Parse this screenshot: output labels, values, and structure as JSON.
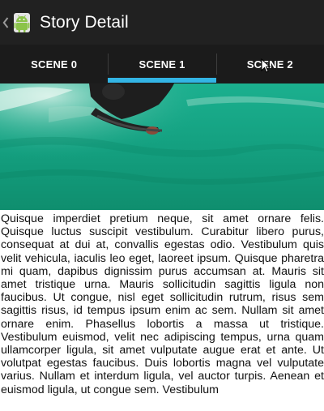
{
  "action_bar": {
    "title": "Story Detail",
    "up_icon": "chevron-left-icon",
    "app_icon": "android-icon"
  },
  "tabs": [
    {
      "label": "SCENE 0",
      "selected": false
    },
    {
      "label": "SCENE 1",
      "selected": true
    },
    {
      "label": "SCENE 2",
      "selected": false
    }
  ],
  "colors": {
    "action_bar_bg": "#212121",
    "tab_bar_bg": "#1b1b1b",
    "tab_indicator": "#33b5e5",
    "water": "#17a585"
  },
  "story": {
    "text": "Quisque imperdiet pretium neque, sit amet ornare felis. Quisque luctus suscipit vestibulum. Curabitur libero purus, consequat at dui at, convallis egestas odio. Vestibulum quis velit vehicula, iaculis leo eget, laoreet ipsum. Quisque pharetra mi quam, dapibus dignissim purus accumsan at. Mauris sit amet tristique urna. Mauris sollicitudin sagittis ligula non faucibus. Ut congue, nisl eget sollicitudin rutrum, risus sem sagittis risus, id tempus ipsum enim ac sem. Nullam sit amet ornare enim. Phasellus lobortis a massa ut tristique. Vestibulum euismod, velit nec adipiscing tempus, urna quam ullamcorper ligula, sit amet vulputate augue erat et ante. Ut volutpat egestas faucibus. Duis lobortis magna vel vulputate varius. Nullam et interdum ligula, vel auctor turpis. Aenean et euismod ligula, ut congue sem. Vestibulum"
  }
}
